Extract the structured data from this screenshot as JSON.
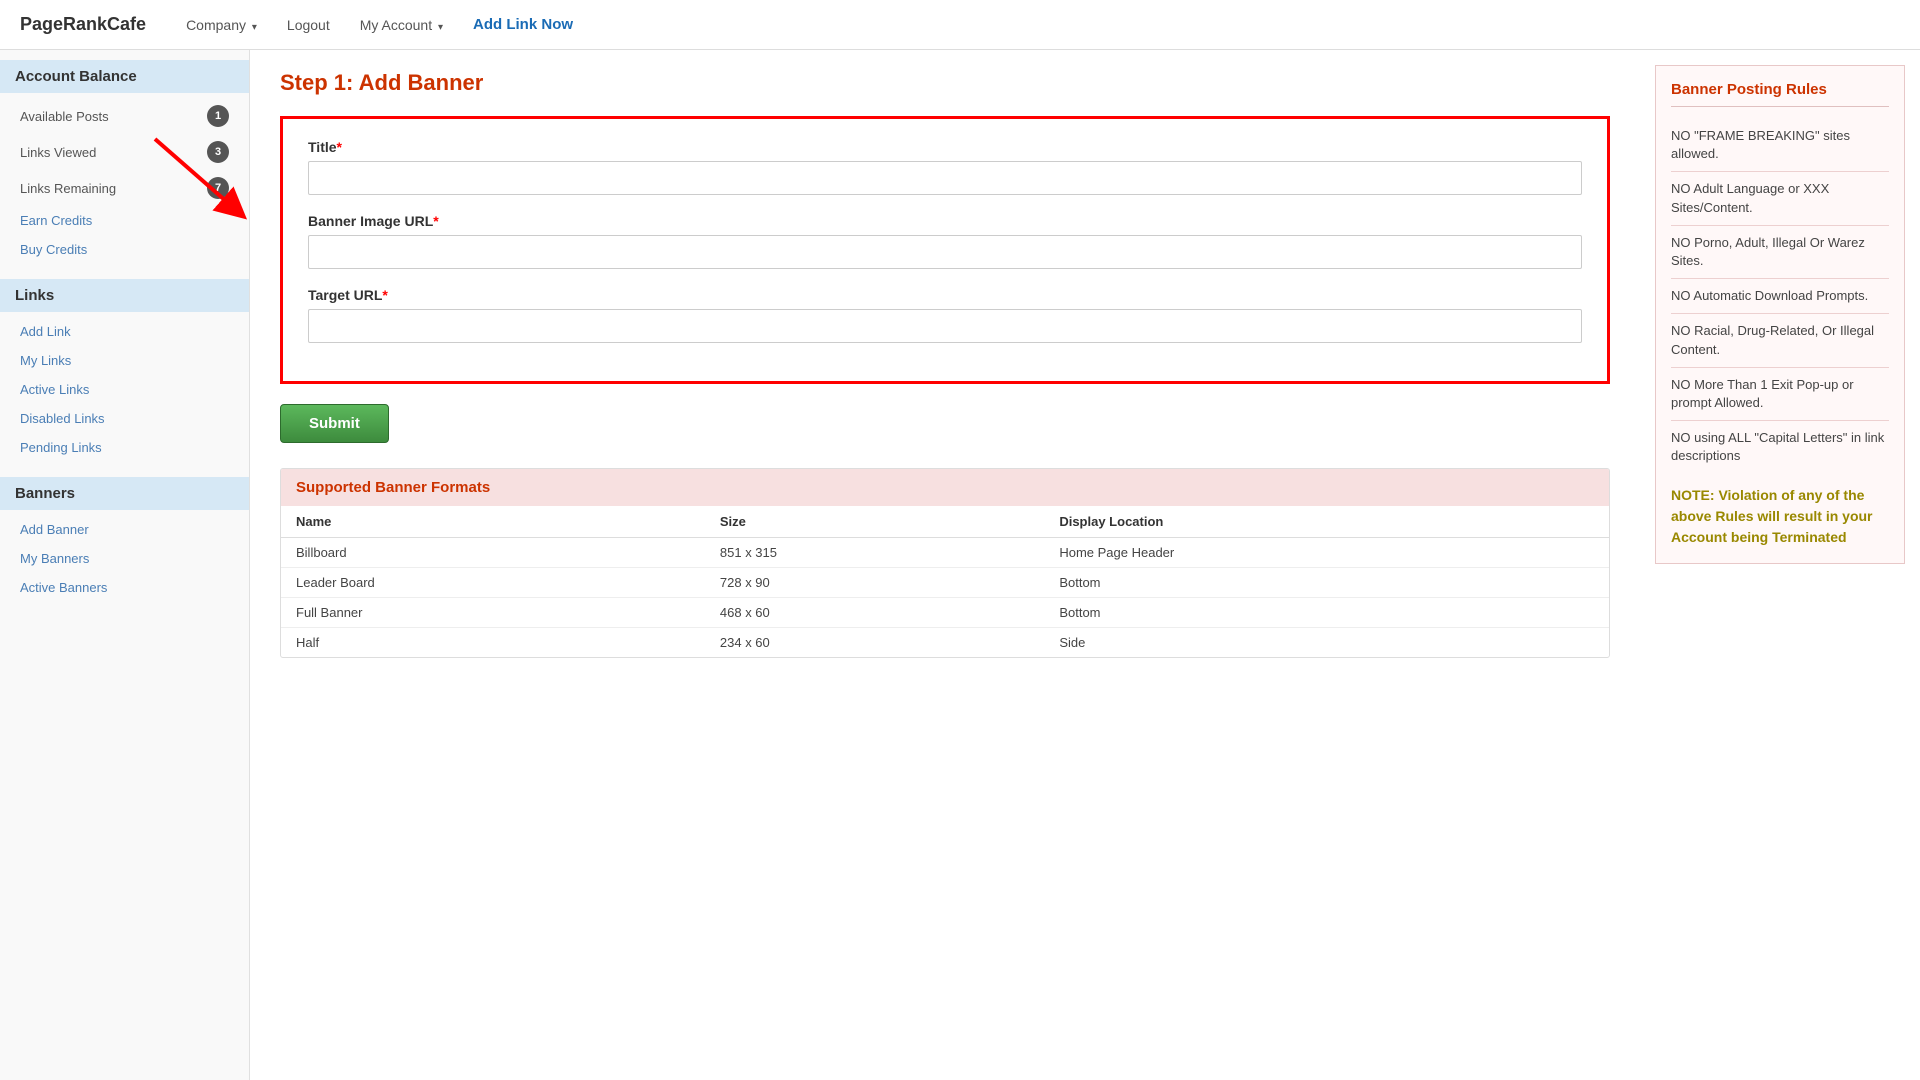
{
  "navbar": {
    "brand": "PageRankCafe",
    "items": [
      {
        "label": "Company",
        "dropdown": true
      },
      {
        "label": "Logout",
        "dropdown": false
      },
      {
        "label": "My Account",
        "dropdown": true
      },
      {
        "label": "Add Link Now",
        "dropdown": false,
        "highlight": true
      }
    ]
  },
  "sidebar": {
    "account_balance_header": "Account Balance",
    "account_items": [
      {
        "label": "Available Posts",
        "badge": "1"
      },
      {
        "label": "Links Viewed",
        "badge": "3"
      },
      {
        "label": "Links Remaining",
        "badge": "7"
      },
      {
        "label": "Earn Credits",
        "link": true
      },
      {
        "label": "Buy Credits",
        "link": true
      }
    ],
    "links_header": "Links",
    "links_items": [
      {
        "label": "Add Link"
      },
      {
        "label": "My Links"
      },
      {
        "label": "Active Links"
      },
      {
        "label": "Disabled Links"
      },
      {
        "label": "Pending Links"
      }
    ],
    "banners_header": "Banners",
    "banners_items": [
      {
        "label": "Add Banner"
      },
      {
        "label": "My Banners"
      },
      {
        "label": "Active Banners"
      }
    ]
  },
  "main": {
    "page_title": "Step 1: Add Banner",
    "form": {
      "title_label": "Title",
      "title_required": "*",
      "title_placeholder": "",
      "banner_image_url_label": "Banner Image URL",
      "banner_image_url_required": "*",
      "banner_image_url_placeholder": "",
      "target_url_label": "Target URL",
      "target_url_required": "*",
      "target_url_placeholder": "",
      "submit_label": "Submit"
    },
    "formats_table": {
      "header": "Supported Banner Formats",
      "columns": [
        "Name",
        "Size",
        "Display Location"
      ],
      "rows": [
        {
          "name": "Billboard",
          "size": "851 x 315",
          "location": "Home Page Header"
        },
        {
          "name": "Leader Board",
          "size": "728 x 90",
          "location": "Bottom"
        },
        {
          "name": "Full Banner",
          "size": "468 x 60",
          "location": "Bottom"
        },
        {
          "name": "Half",
          "size": "234 x 60",
          "location": "Side"
        }
      ]
    }
  },
  "right_panel": {
    "rules_title": "Banner Posting Rules",
    "rules": [
      "NO \"FRAME BREAKING\" sites allowed.",
      "NO Adult Language or XXX Sites/Content.",
      "NO Porno, Adult, Illegal Or Warez Sites.",
      "NO Automatic Download Prompts.",
      "NO Racial, Drug-Related, Or Illegal Content.",
      "NO More Than 1 Exit Pop-up or prompt Allowed.",
      "NO using ALL \"Capital Letters\" in link descriptions"
    ],
    "note": "NOTE: Violation of any of the above Rules will result in your Account being Terminated"
  }
}
